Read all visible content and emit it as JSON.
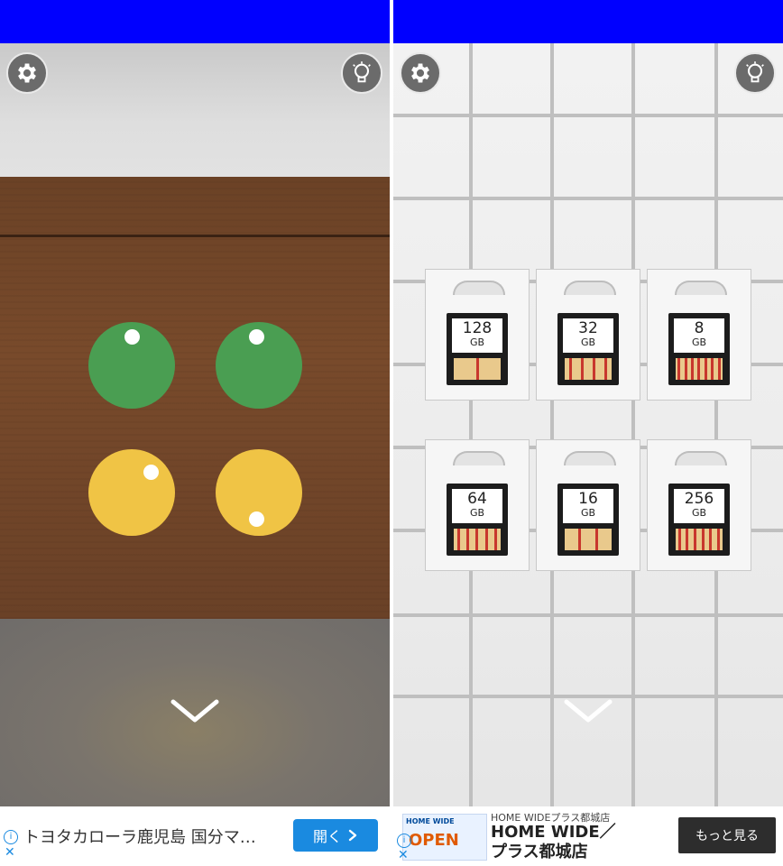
{
  "colors": {
    "topbar": "#0000ff",
    "green_disc": "#4a9e52",
    "yellow_disc": "#f0c445",
    "ad_button": "#1a8ae0"
  },
  "left_scene": {
    "settings_icon": "gear-icon",
    "hint_icon": "lightbulb-icon",
    "back_icon": "chevron-down-icon",
    "discs": [
      {
        "color": "green",
        "dot": "top-center"
      },
      {
        "color": "green",
        "dot": "top-center"
      },
      {
        "color": "yellow",
        "dot": "top-right"
      },
      {
        "color": "yellow",
        "dot": "bottom-center"
      }
    ],
    "ad": {
      "text": "トヨタカローラ鹿児島 国分マ…",
      "button_label": "開く",
      "button_icon": "chevron-right-icon",
      "info_icon": "info-icon",
      "close_icon": "close-icon"
    }
  },
  "right_scene": {
    "settings_icon": "gear-icon",
    "hint_icon": "lightbulb-icon",
    "back_icon": "chevron-down-icon",
    "sd_cards": [
      {
        "capacity": "128",
        "unit": "GB",
        "stripes": 1
      },
      {
        "capacity": "32",
        "unit": "GB",
        "stripes": 4
      },
      {
        "capacity": "8",
        "unit": "GB",
        "stripes": 7
      },
      {
        "capacity": "64",
        "unit": "GB",
        "stripes": 5
      },
      {
        "capacity": "16",
        "unit": "GB",
        "stripes": 2
      },
      {
        "capacity": "256",
        "unit": "GB",
        "stripes": 6
      }
    ],
    "ad": {
      "image_brand": "HOME WIDE",
      "image_text": "OPEN",
      "subtitle": "HOME WIDEプラス都城店",
      "title_line1": "HOME WIDE／",
      "title_line2": "プラス都城店",
      "button_label": "もっと見る",
      "info_icon": "info-icon",
      "close_icon": "close-icon"
    }
  }
}
